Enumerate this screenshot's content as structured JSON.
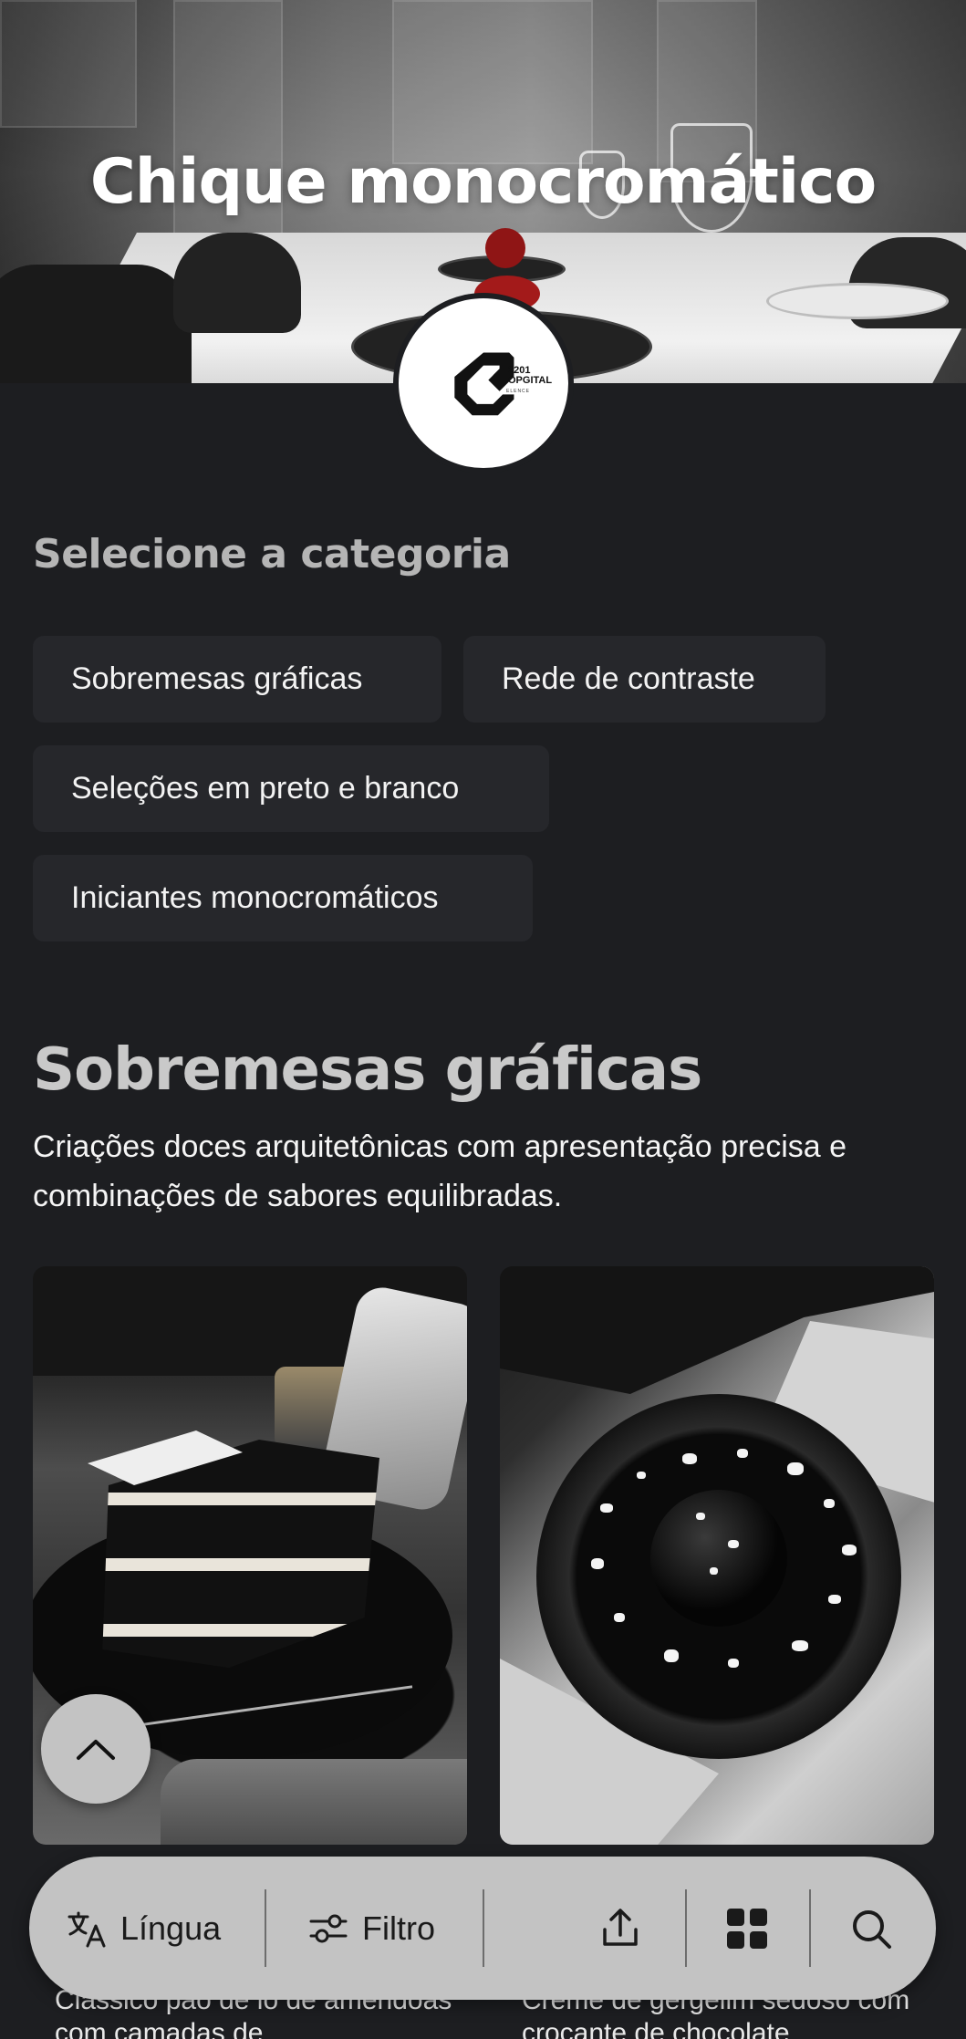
{
  "hero": {
    "title": "Chique monocromático"
  },
  "logo": {
    "line1": "2201",
    "line2": "OPGITAL",
    "sub": "ELENCE"
  },
  "categories": {
    "label": "Selecione a categoria",
    "items": [
      {
        "label": "Sobremesas gráficas"
      },
      {
        "label": "Rede de contraste"
      },
      {
        "label": "Seleções em preto e branco"
      },
      {
        "label": "Iniciantes monocromáticos"
      }
    ]
  },
  "section": {
    "title": "Sobremesas gráficas",
    "description": "Criações doces arquitetônicas com apresentação precisa e combinações de sabores equilibradas."
  },
  "cards": [
    {
      "image_icon": "layered-cake-photo",
      "description_visible": "Clássico pão de ló de amêndoas com camadas de"
    },
    {
      "image_icon": "dessert-dome-photo",
      "description_visible": "Creme de gergelim sedoso com crocante de chocolate"
    }
  ],
  "bottom_bar": {
    "language_label": "Língua",
    "filter_label": "Filtro",
    "icons": [
      "translate-icon",
      "filter-icon",
      "share-icon",
      "grid-icon",
      "search-icon"
    ]
  },
  "colors": {
    "background": "#1d1e21",
    "chip_background": "#26272b",
    "bar_background": "#c3c3c3"
  }
}
